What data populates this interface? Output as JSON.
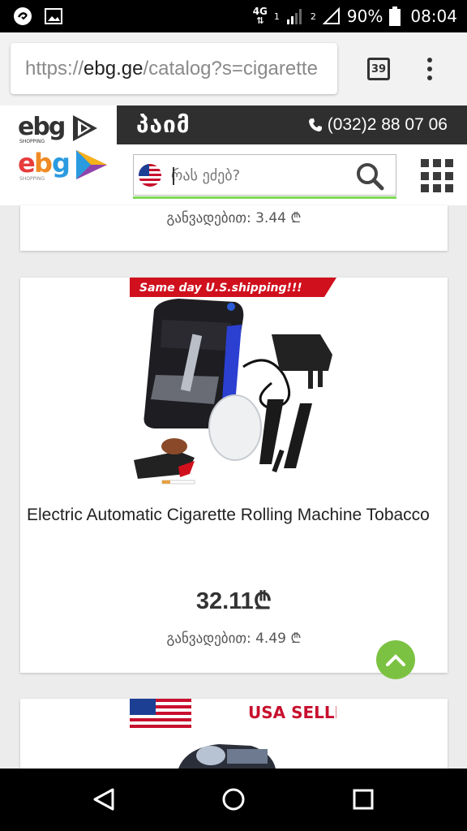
{
  "status_bar": {
    "network": "4G",
    "sim1": "1",
    "sim2": "2",
    "battery": "90%",
    "time": "08:04"
  },
  "browser": {
    "url_scheme": "https://",
    "url_host": "ebg.ge",
    "url_path": "/catalog?s=cigarette",
    "tab_count": "39"
  },
  "site": {
    "brand_label": "პაიმ",
    "phone": "(032)2 88 07 06",
    "search_placeholder": "რას ეძებ?",
    "logo_text": "ebg",
    "logo_subtext": "SHOPPING"
  },
  "products": {
    "prev": {
      "installment": "განვადებით: 3.44 ₾"
    },
    "main": {
      "banner": "Same day U.S.shipping!!!",
      "title": "Electric Automatic Cigarette Rolling Machine Tobacco",
      "price": "32.11₾",
      "installment": "განვადებით: 4.49 ₾"
    },
    "next": {
      "banner": "USA SELLER"
    }
  },
  "colors": {
    "accent_green": "#7cc242",
    "header_dark": "#2f2f2f",
    "banner_red": "#d0101d"
  }
}
